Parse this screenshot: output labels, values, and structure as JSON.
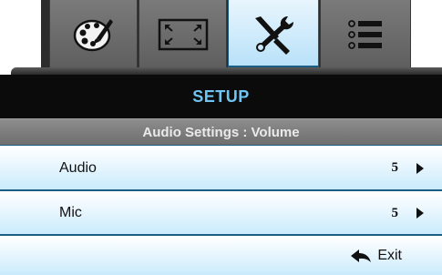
{
  "tabs": [
    {
      "name": "image",
      "icon": "palette-icon",
      "active": false
    },
    {
      "name": "display",
      "icon": "screen-resize-icon",
      "active": false
    },
    {
      "name": "setup",
      "icon": "tools-icon",
      "active": true
    },
    {
      "name": "options",
      "icon": "list-icon",
      "active": false
    }
  ],
  "header": {
    "title": "SETUP",
    "subtitle": "Audio Settings : Volume"
  },
  "rows": [
    {
      "label": "Audio",
      "value": "5"
    },
    {
      "label": "Mic",
      "value": "5"
    }
  ],
  "exit": {
    "label": "Exit"
  },
  "colors": {
    "accent": "#6fc4f1",
    "tab_bg": "#6b6b6b",
    "row_bg": "#c9ebfb",
    "divider": "#1c5d86"
  }
}
